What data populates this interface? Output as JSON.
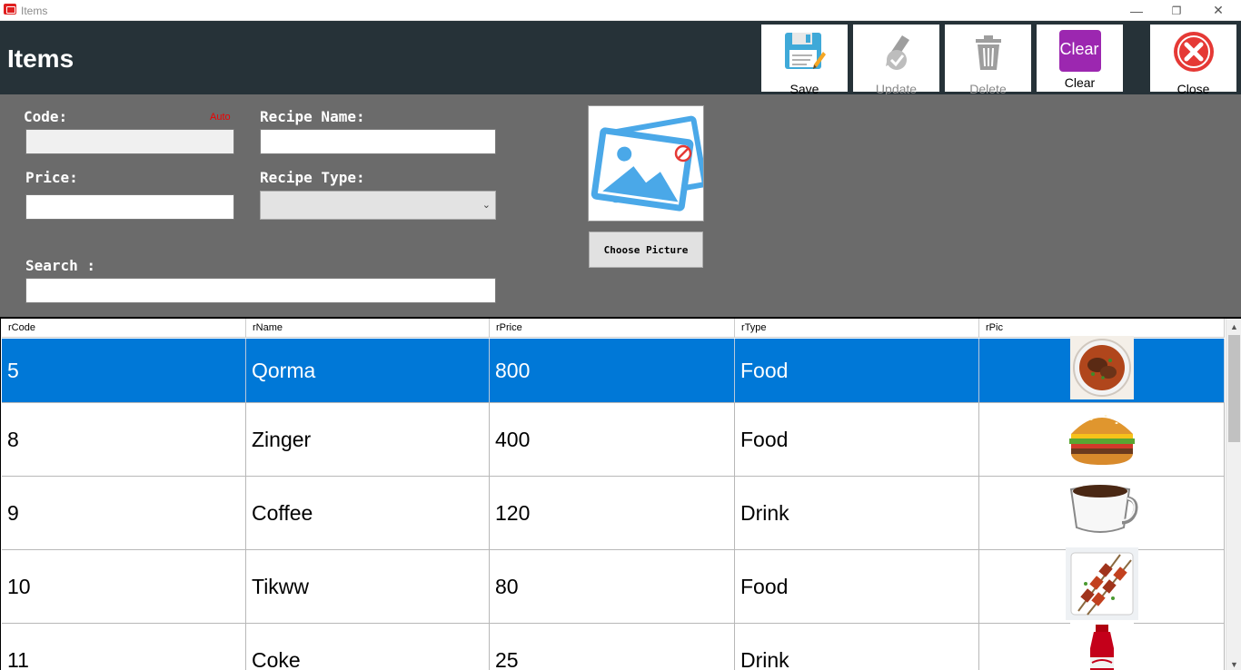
{
  "window": {
    "title": "Items",
    "minimize": "—",
    "restore": "❐",
    "close": "✕"
  },
  "header": {
    "title": "Items"
  },
  "toolbar": {
    "save_label": "Save",
    "update_label": "Update",
    "delete_label": "Delete",
    "clear_label": "Clear",
    "close_label": "Close",
    "clear_icon_text": "Clear"
  },
  "form": {
    "code_label": "Code:",
    "code_auto": "Auto",
    "code_value": "",
    "recipe_name_label": "Recipe Name:",
    "recipe_name_value": "",
    "price_label": "Price:",
    "price_value": "",
    "recipe_type_label": "Recipe Type:",
    "recipe_type_value": "",
    "search_label": "Search :",
    "search_value": "",
    "choose_picture_label": "Choose Picture"
  },
  "grid": {
    "columns": [
      "rCode",
      "rName",
      "rPrice",
      "rType",
      "rPic"
    ],
    "rows": [
      {
        "code": "5",
        "name": "Qorma",
        "price": "800",
        "type": "Food",
        "pic": "qorma-image",
        "selected": true
      },
      {
        "code": "8",
        "name": "Zinger",
        "price": "400",
        "type": "Food",
        "pic": "burger-image",
        "selected": false
      },
      {
        "code": "9",
        "name": "Coffee",
        "price": "120",
        "type": "Drink",
        "pic": "coffee-cup-image",
        "selected": false
      },
      {
        "code": "10",
        "name": "Tikww",
        "price": "80",
        "type": "Food",
        "pic": "skewers-image",
        "selected": false
      },
      {
        "code": "11",
        "name": "Coke",
        "price": "25",
        "type": "Drink",
        "pic": "cola-bottle-image",
        "selected": false
      }
    ]
  },
  "colors": {
    "header_bg": "#263238",
    "form_bg": "#6b6b6b",
    "selection": "#0078d7",
    "clear_icon": "#9c27b0",
    "close_icon": "#e53935",
    "save_icon": "#3fa9d8"
  }
}
